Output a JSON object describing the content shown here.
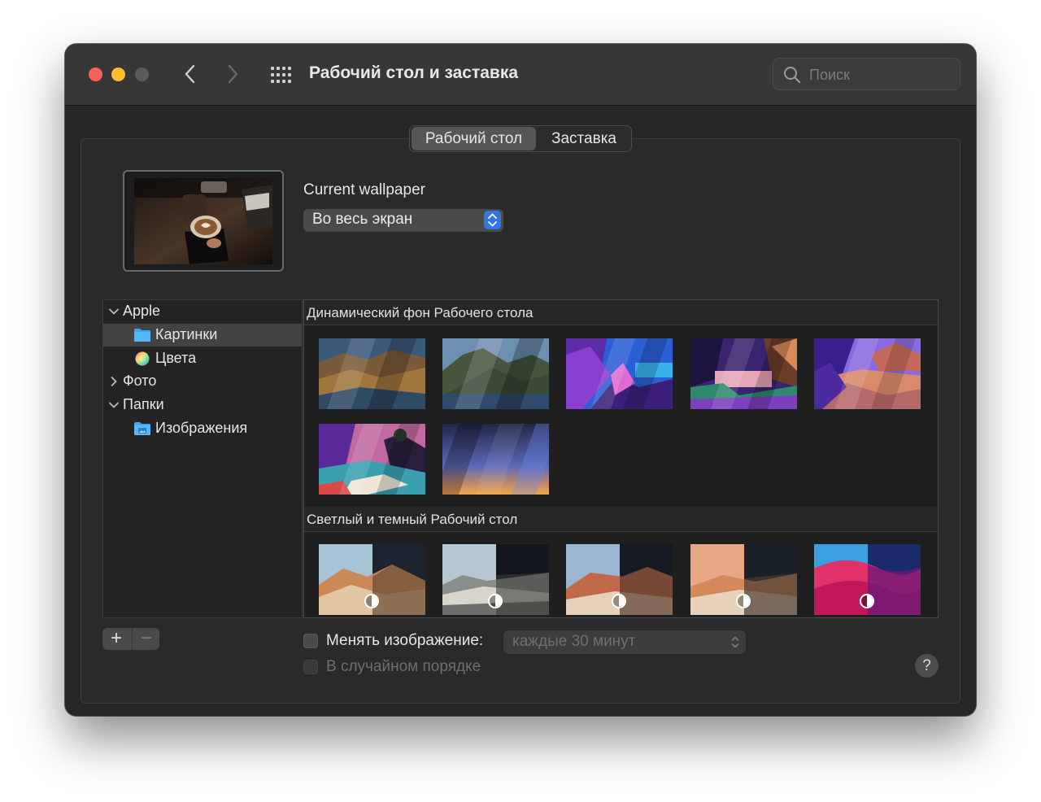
{
  "window": {
    "title": "Рабочий стол и заставка"
  },
  "search": {
    "placeholder": "Поиск"
  },
  "tabs": [
    {
      "label": "Рабочий стол",
      "selected": true
    },
    {
      "label": "Заставка",
      "selected": false
    }
  ],
  "current": {
    "label": "Current wallpaper",
    "fit_option": "Во весь экран"
  },
  "sidebar": {
    "items": [
      {
        "label": "Apple",
        "expanded": true
      },
      {
        "label": "Картинки",
        "selected": true,
        "icon": "folder-icon"
      },
      {
        "label": "Цвета",
        "icon": "color-wheel-icon"
      },
      {
        "label": "Фото",
        "expanded": false
      },
      {
        "label": "Папки",
        "expanded": true
      },
      {
        "label": "Изображения",
        "icon": "pictures-folder-icon"
      }
    ]
  },
  "gallery": {
    "sections": [
      {
        "title": "Динамический фон Рабочего стола",
        "count": 7
      },
      {
        "title": "Светлый и темный Рабочий стол",
        "count": 5
      }
    ]
  },
  "footer": {
    "change_label": "Менять изображение:",
    "change_checked": false,
    "interval": "каждые 30 минут",
    "random_label": "В случайном порядке",
    "random_checked": false,
    "help": "?"
  },
  "colors": {
    "close": "#fe5f57",
    "minimize": "#febc2e",
    "accent": "#2f78e0",
    "window_bg": "#262626"
  }
}
